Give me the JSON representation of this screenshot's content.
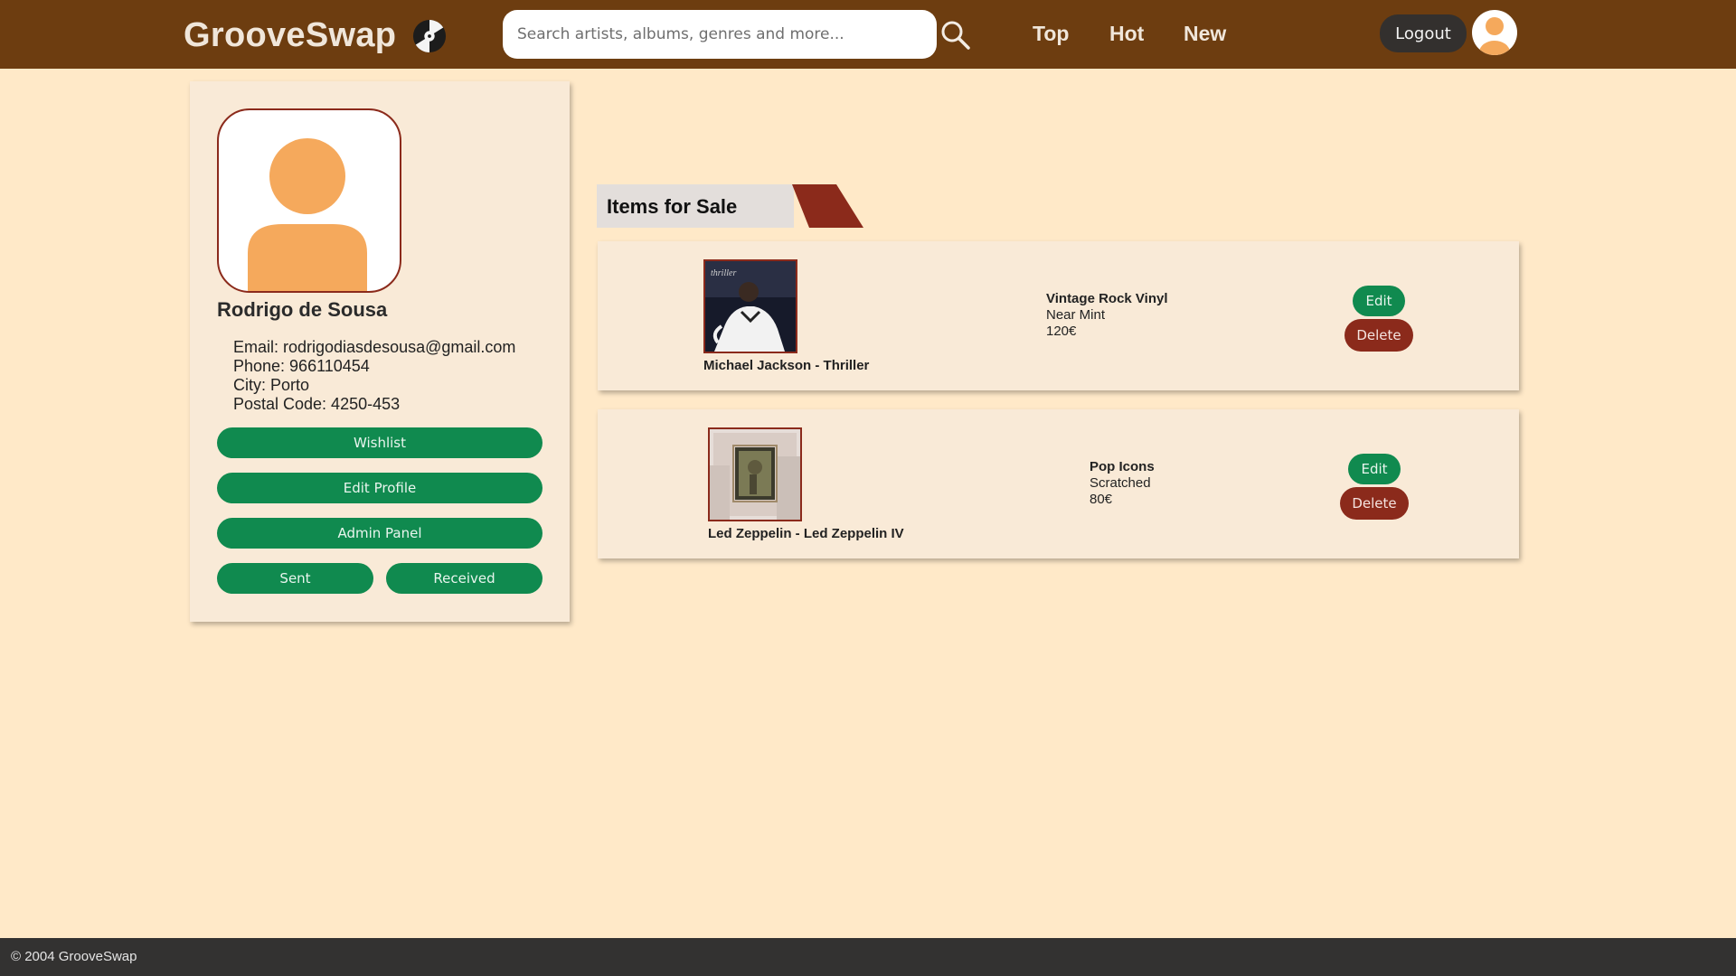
{
  "header": {
    "brand": "GrooveSwap",
    "brand_icon": "vinyl-record-icon",
    "search_placeholder": "Search artists, albums, genres and more...",
    "search_icon": "search-icon",
    "nav": [
      "Top",
      "Hot",
      "New"
    ],
    "logout_label": "Logout",
    "avatar_icon": "user-avatar-icon"
  },
  "profile": {
    "photo_icon": "user-avatar-icon",
    "name": "Rodrigo de Sousa",
    "email": "Email: rodrigodiasdesousa@gmail.com",
    "phone": "Phone: 966110454",
    "city": "City: Porto",
    "postal": "Postal Code: 4250-453",
    "buttons": {
      "wishlist": "Wishlist",
      "edit_profile": "Edit Profile",
      "admin_panel": "Admin Panel",
      "sent": "Sent",
      "received": "Received"
    }
  },
  "items_section": {
    "title": "Items for Sale",
    "items": [
      {
        "title": "Michael Jackson - Thriller",
        "name": "Vintage Rock Vinyl",
        "condition": "Near Mint",
        "price": "120€",
        "edit_label": "Edit",
        "delete_label": "Delete"
      },
      {
        "title": "Led Zeppelin - Led Zeppelin IV",
        "name": "Pop Icons",
        "condition": "Scratched",
        "price": "80€",
        "edit_label": "Edit",
        "delete_label": "Delete"
      }
    ]
  },
  "footer": {
    "copyright": "© 2004 GrooveSwap"
  },
  "colors": {
    "header_bg": "#6d3d10",
    "page_bg": "#ffe9c8",
    "card_bg": "#f9ead7",
    "green": "#108a4f",
    "red": "#8b2a1b",
    "avatar_orange": "#f5a95c",
    "footer_bg": "#333231"
  }
}
